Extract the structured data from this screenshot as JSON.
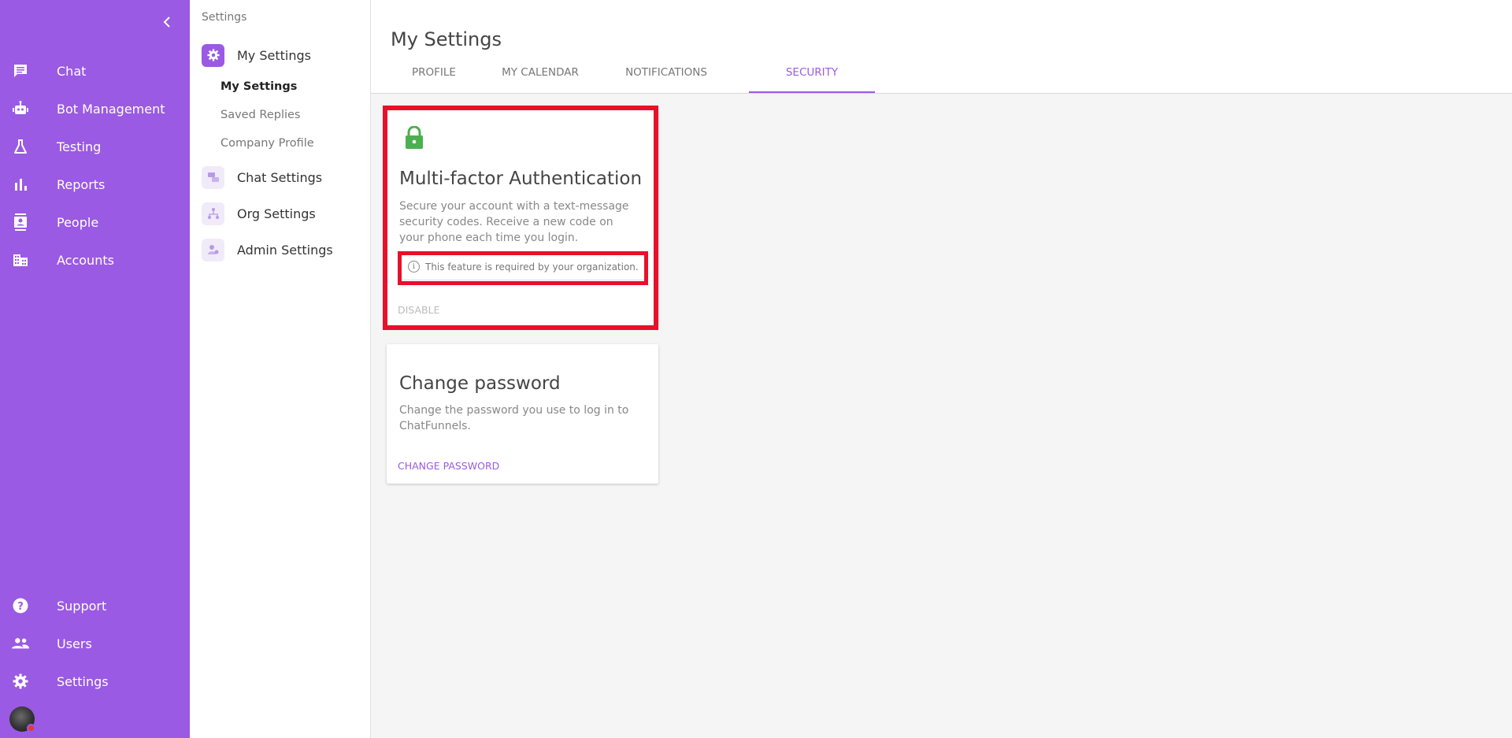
{
  "nav": {
    "items": [
      {
        "label": "Chat",
        "icon": "chat-icon"
      },
      {
        "label": "Bot Management",
        "icon": "robot-icon"
      },
      {
        "label": "Testing",
        "icon": "flask-icon"
      },
      {
        "label": "Reports",
        "icon": "bar-chart-icon"
      },
      {
        "label": "People",
        "icon": "contact-card-icon"
      },
      {
        "label": "Accounts",
        "icon": "building-icon"
      }
    ],
    "bottom_items": [
      {
        "label": "Support",
        "icon": "help-icon"
      },
      {
        "label": "Users",
        "icon": "users-icon"
      },
      {
        "label": "Settings",
        "icon": "gear-icon"
      }
    ],
    "accent": "#9a5ae3"
  },
  "settings_nav": {
    "breadcrumb": "Settings",
    "sections": [
      {
        "label": "My Settings",
        "icon": "gear-icon",
        "active": true
      },
      {
        "label": "Chat Settings",
        "icon": "chat-bubbles-icon"
      },
      {
        "label": "Org Settings",
        "icon": "org-chart-icon"
      },
      {
        "label": "Admin Settings",
        "icon": "admin-icon"
      }
    ],
    "sub_items": [
      {
        "label": "My Settings",
        "active": true
      },
      {
        "label": "Saved Replies"
      },
      {
        "label": "Company Profile"
      }
    ]
  },
  "main": {
    "title": "My Settings",
    "tabs": [
      {
        "label": "PROFILE"
      },
      {
        "label": "MY CALENDAR"
      },
      {
        "label": "NOTIFICATIONS"
      },
      {
        "label": "SECURITY",
        "active": true
      }
    ],
    "mfa_card": {
      "icon": "lock-icon",
      "icon_color": "#4caf50",
      "title": "Multi-factor Authentication",
      "description": "Secure your account with a text-message security codes. Receive a new code on your phone each time you login.",
      "notice": "This feature is required by your organization.",
      "action": "DISABLE"
    },
    "password_card": {
      "title": "Change password",
      "description": "Change the password you use to log in to ChatFunnels.",
      "action": "CHANGE PASSWORD"
    },
    "highlight_color": "#e8102a"
  }
}
